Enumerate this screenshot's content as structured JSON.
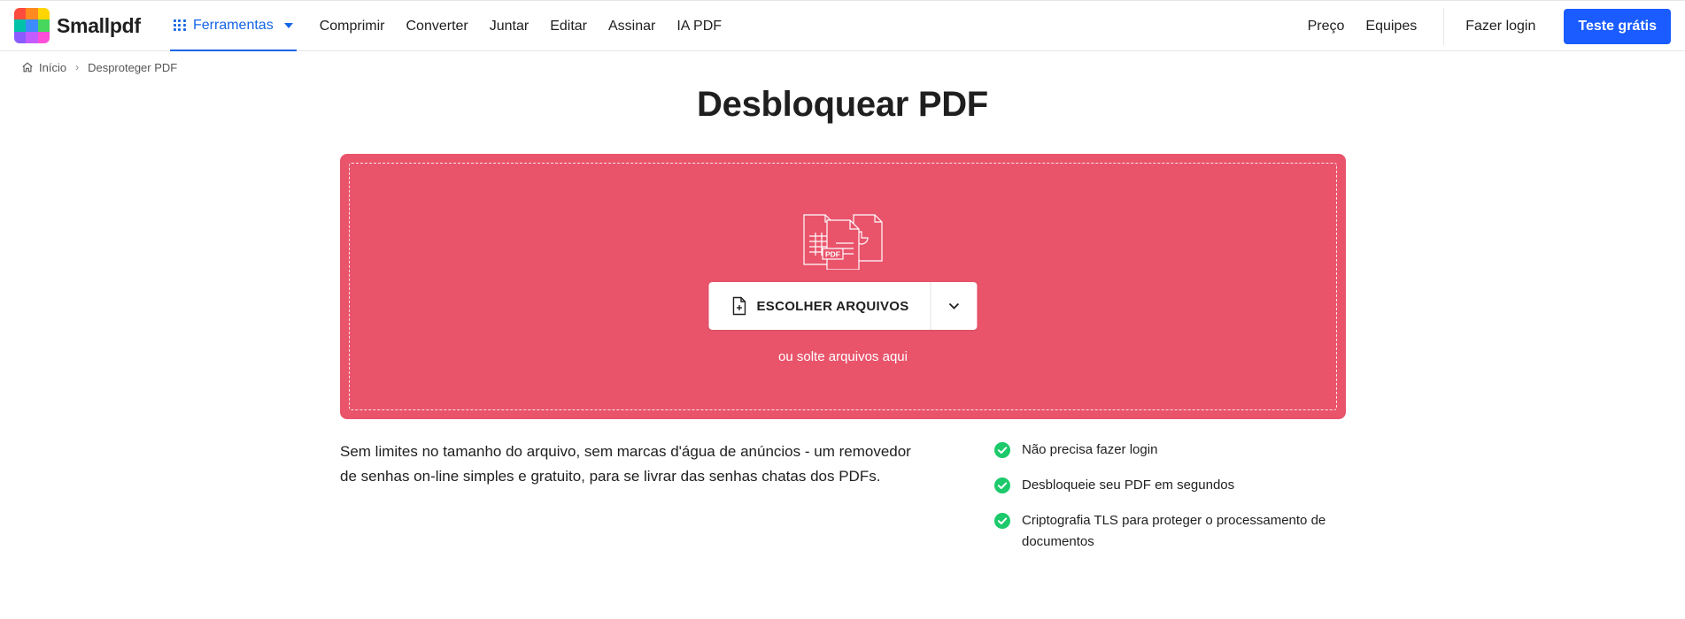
{
  "brand": {
    "name": "Smallpdf",
    "logo_colors": [
      "#ff4b3e",
      "#ffb100",
      "#ffd500",
      "#00c2a8",
      "#3c8cff",
      "#46d75c",
      "#8a5cff",
      "#ff4fd8",
      "#ff7bd0"
    ]
  },
  "header": {
    "tools_label": "Ferramentas",
    "nav_links": [
      "Comprimir",
      "Converter",
      "Juntar",
      "Editar",
      "Assinar",
      "IA PDF"
    ],
    "right_links": [
      "Preço",
      "Equipes"
    ],
    "login_label": "Fazer login",
    "cta_label": "Teste grátis",
    "accent_color": "#1a5cff"
  },
  "breadcrumb": {
    "home": "Início",
    "current": "Desproteger PDF"
  },
  "page": {
    "title": "Desbloquear PDF"
  },
  "dropzone": {
    "background_color": "#e9546b",
    "illustration_label": "PDF",
    "choose_label": "ESCOLHER ARQUIVOS",
    "drop_hint": "ou solte arquivos aqui"
  },
  "description": "Sem limites no tamanho do arquivo, sem marcas d'água de anúncios - um removedor de senhas on-line simples e gratuito, para se livrar das senhas chatas dos PDFs.",
  "features": [
    "Não precisa fazer login",
    "Desbloqueie seu PDF em segundos",
    "Criptografia TLS para proteger o processamento de documentos"
  ],
  "check_color": "#1cc96b"
}
